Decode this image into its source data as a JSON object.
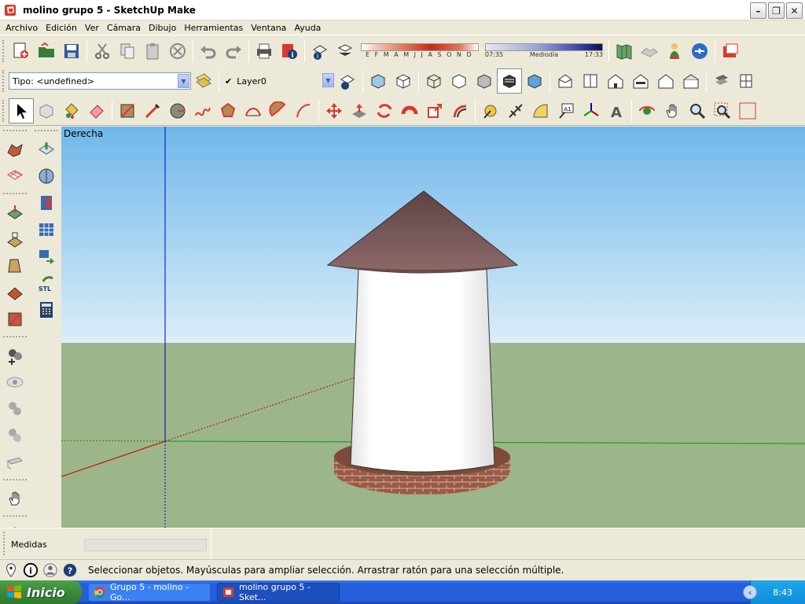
{
  "window": {
    "title": "molino grupo 5 - SketchUp Make"
  },
  "menu": [
    "Archivo",
    "Edición",
    "Ver",
    "Cámara",
    "Dibujo",
    "Herramientas",
    "Ventana",
    "Ayuda"
  ],
  "shadows": {
    "months": "E F M A M J J A S O N D",
    "time_start": "07:35",
    "time_mid": "Mediodía",
    "time_end": "17:33"
  },
  "entity": {
    "type_label": "Tipo: <undefined>",
    "layer": "Layer0"
  },
  "viewport": {
    "scene_label": "Derecha"
  },
  "measurements": {
    "label": "Medidas",
    "value": ""
  },
  "status": {
    "text": "Seleccionar objetos. Mayúsculas para ampliar selección. Arrastrar ratón para una selección múltiple."
  },
  "taskbar": {
    "start": "Inicio",
    "tasks": [
      "Grupo 5 - molino - Go...",
      "molino grupo 5 - Sket..."
    ],
    "clock": "8:43"
  },
  "colors": {
    "sky_top": "#6fb7ea",
    "sky_bottom": "#d9ecf7",
    "ground": "#9cb58a",
    "roof": "#7a5c5c",
    "tower": "#ffffff",
    "base_brick": "#9a5a45",
    "axis_red": "#c40000",
    "axis_green": "#00a000",
    "axis_blue": "#0000c8"
  }
}
